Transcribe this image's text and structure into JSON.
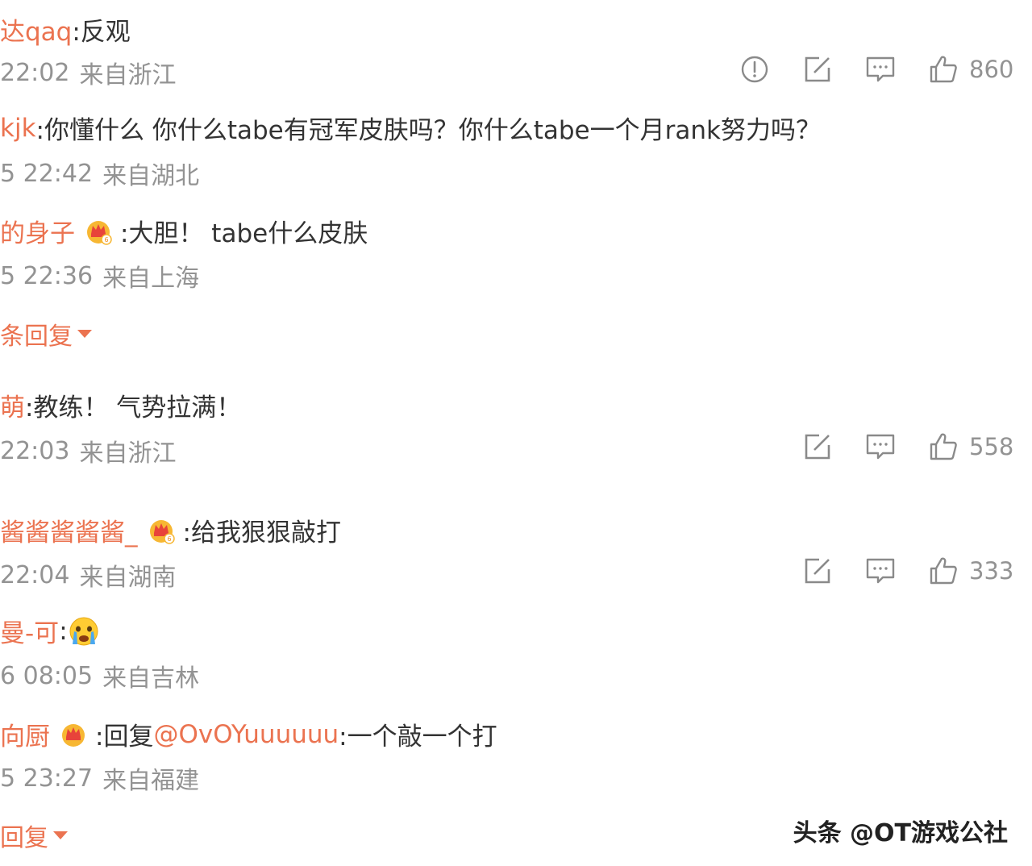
{
  "comments": [
    {
      "user": "达qaq",
      "text": ":反观",
      "time": "22:02",
      "location": "来自浙江",
      "likes": "860"
    },
    {
      "user": "kjk",
      "text": ":你懂什么 你什么tabe有冠军皮肤吗？你什么tabe一个月rank努力吗？",
      "time": "5 22:42",
      "location": "来自湖北"
    },
    {
      "user": "的身子",
      "text": ":大胆！ tabe什么皮肤",
      "time": "5 22:36",
      "location": "来自上海",
      "replies_toggle": "条回复"
    },
    {
      "user": "萌",
      "text": ":教练！ 气势拉满！",
      "time": "22:03",
      "location": "来自浙江",
      "likes": "558"
    },
    {
      "user": "酱酱酱酱酱_",
      "text": ":给我狠狠敲打",
      "time": "22:04",
      "location": "来自湖南",
      "likes": "333"
    },
    {
      "user": "曼-可",
      "text": ":",
      "time": "6 08:05",
      "location": "来自吉林"
    },
    {
      "user": "向厨",
      "text_prefix": ":回复",
      "mention": "@OvOYuuuuuu",
      "text_suffix": ":一个敲一个打",
      "time": "5 23:27",
      "location": "来自福建",
      "replies_toggle": "回复"
    }
  ],
  "watermark": "头条 @OT游戏公社",
  "colors": {
    "username": "#eb7350",
    "meta": "#939393",
    "text": "#333333"
  },
  "icons": {
    "report": "report-icon",
    "share": "share-icon",
    "comment": "comment-icon",
    "like": "like-icon",
    "badge": "vip-crown-badge-icon",
    "emoji": "crying-face-emoji-icon"
  }
}
